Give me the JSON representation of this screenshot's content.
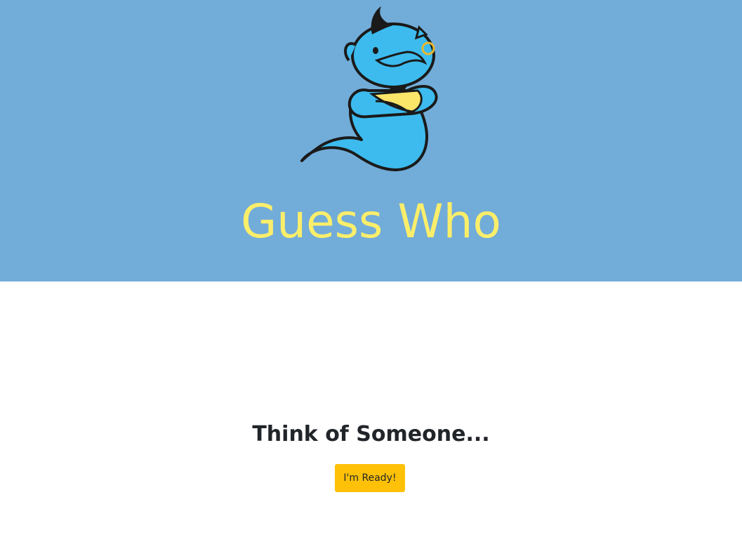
{
  "header": {
    "title": "Guess Who",
    "background_color": "#72acd9",
    "title_color": "#fbee6a",
    "logo_icon": "genie-mascot-icon"
  },
  "main": {
    "prompt": "Think of Someone...",
    "ready_button_label": "I'm Ready!",
    "button_color": "#ffc107"
  }
}
